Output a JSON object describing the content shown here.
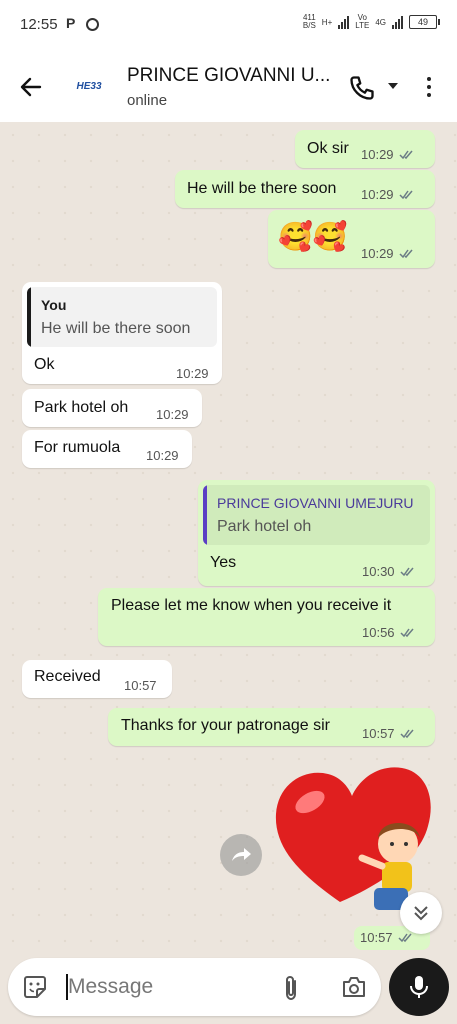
{
  "status_bar": {
    "time": "12:55",
    "p_indicator": "P",
    "speed": "411",
    "speed_unit": "B/S",
    "net1": "H+",
    "volte_top": "Vo",
    "volte_bottom": "LTE",
    "net2": "4G",
    "battery": "49"
  },
  "header": {
    "avatar_text": "HE33",
    "title": "PRINCE GIOVANNI U...",
    "subtitle": "online"
  },
  "messages": [
    {
      "text": "Ok sir",
      "time": "10:29"
    },
    {
      "text": "He will be there soon",
      "time": "10:29"
    },
    {
      "text": "🥰🥰",
      "time": "10:29"
    },
    {
      "quote_name": "You",
      "quote_text": "He will be there soon",
      "text": "Ok",
      "time": "10:29"
    },
    {
      "text": "Park hotel oh",
      "time": "10:29"
    },
    {
      "text": "For rumuola",
      "time": "10:29"
    },
    {
      "quote_name": "PRINCE GIOVANNI UMEJURU",
      "quote_text": "Park hotel oh",
      "text": "Yes",
      "time": "10:30"
    },
    {
      "text": "Please let me know when you receive it",
      "time": "10:56"
    },
    {
      "text": "Received",
      "time": "10:57"
    },
    {
      "text": "Thanks for your patronage sir",
      "time": "10:57"
    },
    {
      "time": "10:57"
    }
  ],
  "input": {
    "placeholder": "Message"
  },
  "colors": {
    "outgoing": "#dcf8c6",
    "incoming": "#ffffff",
    "ticks": "#6b7c85",
    "quote_you": "#1b1b1b",
    "quote_other": "#5b3fc4"
  }
}
